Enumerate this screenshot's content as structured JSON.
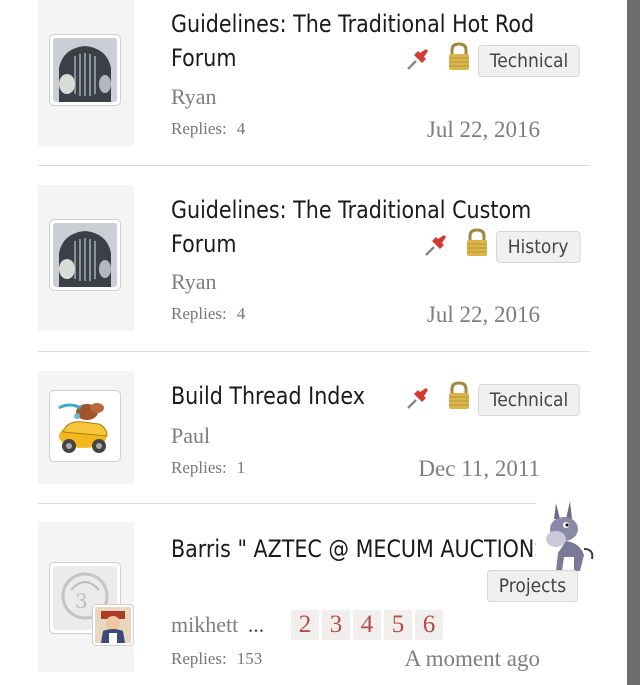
{
  "threads": [
    {
      "title_line1": "Guidelines: The Traditional Hot Rod",
      "title_line2": "Forum",
      "author": "Ryan",
      "replies_label": "Replies:",
      "replies_count": "4",
      "date": "Jul 22, 2016",
      "tag": "Technical",
      "pinned": true,
      "locked": true
    },
    {
      "title_line1": "Guidelines: The Traditional Custom",
      "title_line2": "Forum",
      "author": "Ryan",
      "replies_label": "Replies:",
      "replies_count": "4",
      "date": "Jul 22, 2016",
      "tag": "History",
      "pinned": true,
      "locked": true
    },
    {
      "title_line1": "Build Thread Index",
      "author": "Paul",
      "replies_label": "Replies:",
      "replies_count": "1",
      "date": "Dec 11, 2011",
      "tag": "Technical",
      "pinned": true,
      "locked": true
    },
    {
      "title_line1": "Barris \" AZTEC @ MECUM AUCTIONS.",
      "author": "mikhett",
      "ellipsis": "...",
      "pages": [
        "2",
        "3",
        "4",
        "5",
        "6"
      ],
      "replies_label": "Replies:",
      "replies_count": "153",
      "date": "A moment ago",
      "tag": "Projects"
    }
  ],
  "colors": {
    "page_link": "#b84a46",
    "tag_bg": "#f0f0f0",
    "scrollbar": "#6e6e6e"
  },
  "icons": [
    "pin-icon",
    "lock-icon",
    "donkey-icon"
  ]
}
